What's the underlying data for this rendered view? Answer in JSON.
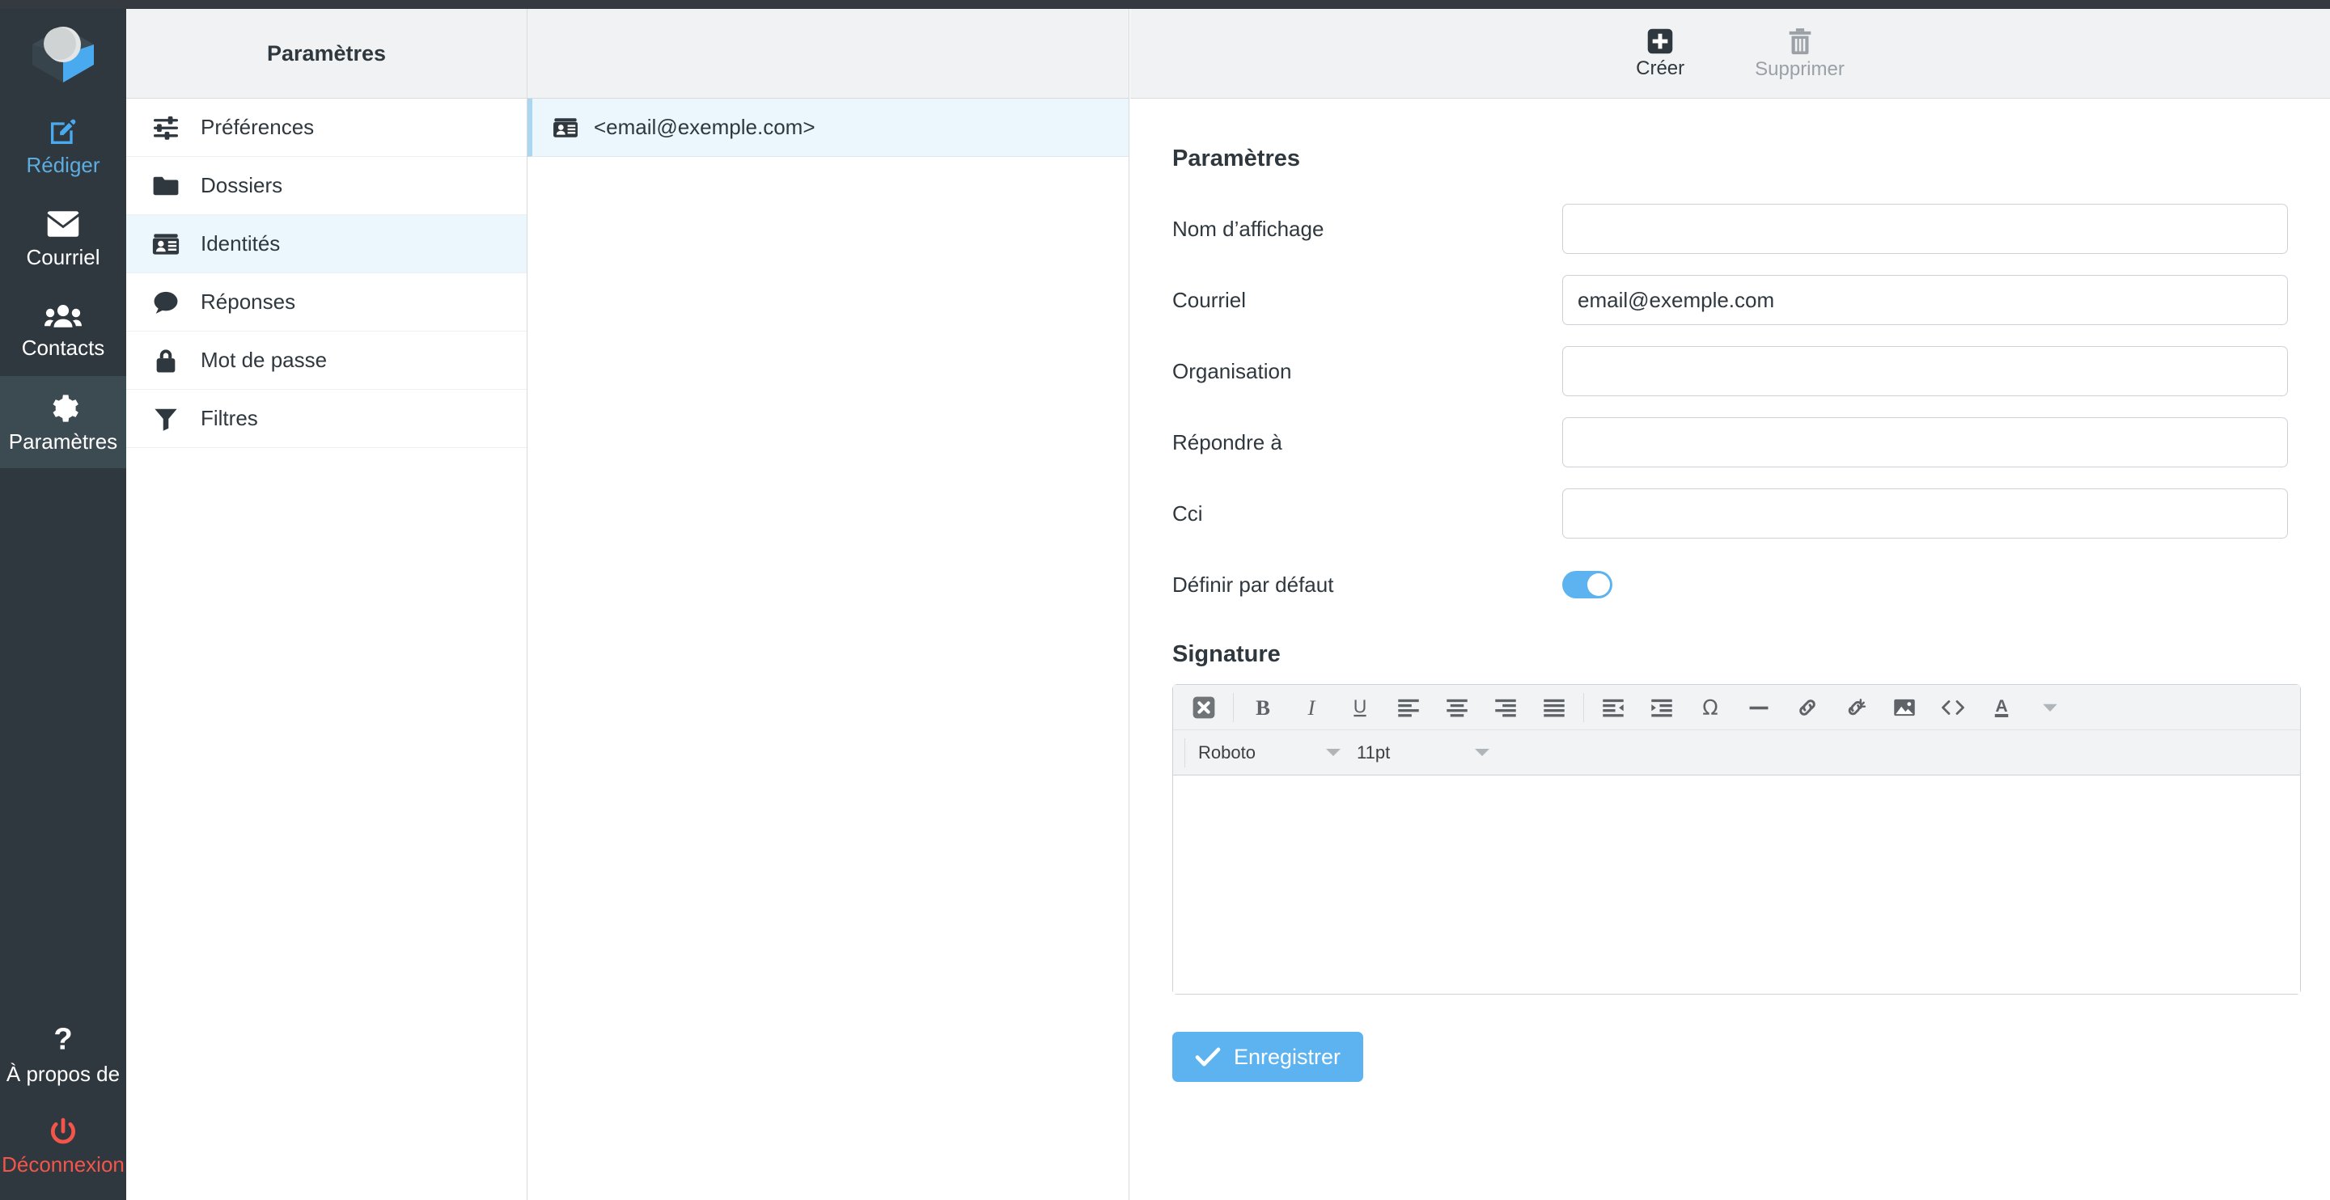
{
  "app": {
    "logo_icon": "roundcube-logo-icon"
  },
  "rail": {
    "items": [
      {
        "label": "Rédiger",
        "icon": "compose-pencil-icon"
      },
      {
        "label": "Courriel",
        "icon": "envelope-icon"
      },
      {
        "label": "Contacts",
        "icon": "contacts-people-icon"
      },
      {
        "label": "Paramètres",
        "icon": "gear-icon"
      }
    ],
    "bottom_items": [
      {
        "label": "À propos de",
        "icon": "question-mark-icon"
      },
      {
        "label": "Déconnexion",
        "icon": "power-icon"
      }
    ]
  },
  "settings_column": {
    "header_title": "Paramètres",
    "items": [
      {
        "label": "Préférences",
        "icon": "sliders-icon"
      },
      {
        "label": "Dossiers",
        "icon": "folder-icon"
      },
      {
        "label": "Identités",
        "icon": "id-card-icon"
      },
      {
        "label": "Réponses",
        "icon": "speech-bubble-icon"
      },
      {
        "label": "Mot de passe",
        "icon": "lock-icon"
      },
      {
        "label": "Filtres",
        "icon": "funnel-icon"
      }
    ],
    "active_index": 2
  },
  "identities_column": {
    "header_title": "",
    "rows": [
      {
        "label": "<email@exemple.com>",
        "icon": "id-card-icon"
      }
    ]
  },
  "pane": {
    "toolbar": [
      {
        "label": "Créer",
        "icon": "plus-square-icon",
        "disabled": false
      },
      {
        "label": "Supprimer",
        "icon": "trash-icon",
        "disabled": true
      }
    ],
    "section_title": "Paramètres",
    "fields": [
      {
        "label": "Nom d’affichage",
        "value": "",
        "placeholder": ""
      },
      {
        "label": "Courriel",
        "value": "email@exemple.com",
        "placeholder": ""
      },
      {
        "label": "Organisation",
        "value": "",
        "placeholder": ""
      },
      {
        "label": "Répondre à",
        "value": "",
        "placeholder": ""
      },
      {
        "label": "Cci",
        "value": "",
        "placeholder": ""
      }
    ],
    "toggle_field": {
      "label": "Définir par défaut",
      "on": true
    },
    "signature": {
      "title": "Signature",
      "toolbar_icons": [
        "source-clear-icon",
        "bold-icon",
        "italic-icon",
        "underline-icon",
        "align-left-icon",
        "align-center-icon",
        "align-right-icon",
        "align-justify-icon",
        "outdent-icon",
        "indent-icon",
        "special-character-icon",
        "horizontal-rule-icon",
        "link-icon",
        "unlink-icon",
        "image-icon",
        "source-code-icon",
        "text-color-icon",
        "text-color-dropdown-icon"
      ],
      "font_family": "Roboto",
      "font_size": "11pt",
      "content": ""
    },
    "save_label": "Enregistrer",
    "save_icon": "check-icon"
  },
  "colors": {
    "accent": "#5cb3f0",
    "rail_bg": "#2f383e",
    "rail_active": "#3c4a52",
    "logout": "#f4554a",
    "selected_row": "#ebf6fd",
    "header_bg": "#f1f2f3"
  }
}
